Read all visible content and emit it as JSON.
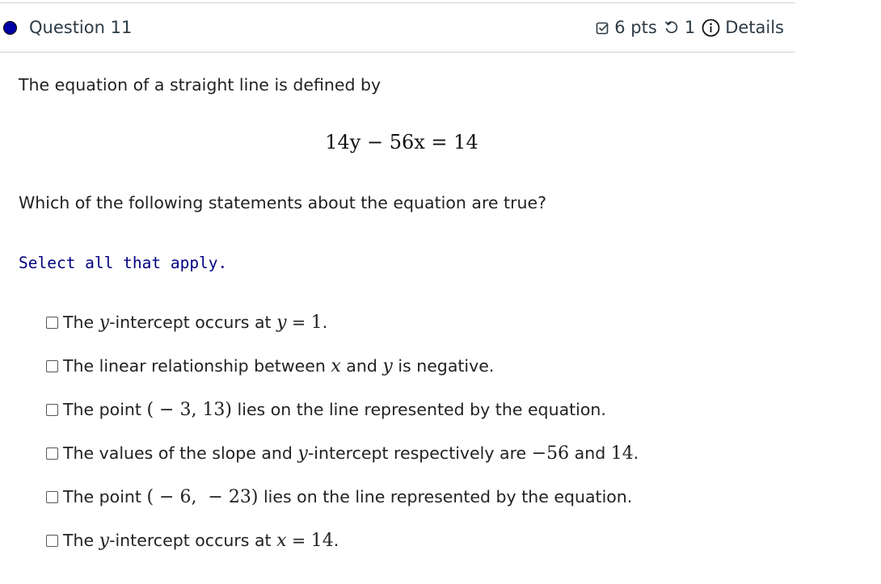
{
  "header": {
    "title": "Question 11",
    "points": "6 pts",
    "attempts": "1",
    "details_label": "Details",
    "status_dot_color": "#0000a8"
  },
  "body": {
    "intro": "The equation of a straight line is defined by",
    "equation": "14y − 56x = 14",
    "question": "Which of the following statements about the equation are true?",
    "instruction": "Select all that apply."
  },
  "options": [
    {
      "parts": [
        {
          "t": "The "
        },
        {
          "m": "y"
        },
        {
          "t": "-intercept occurs at "
        },
        {
          "m": "y"
        },
        {
          "t": " = "
        },
        {
          "n": "1"
        },
        {
          "t": "."
        }
      ],
      "checked": false
    },
    {
      "parts": [
        {
          "t": "The linear relationship between "
        },
        {
          "m": "x"
        },
        {
          "t": " and "
        },
        {
          "m": "y"
        },
        {
          "t": " is negative."
        }
      ],
      "checked": false
    },
    {
      "parts": [
        {
          "t": "The point "
        },
        {
          "n": "( − 3, 13)"
        },
        {
          "t": " lies on the line represented by the equation."
        }
      ],
      "checked": false
    },
    {
      "parts": [
        {
          "t": "The values of the slope and "
        },
        {
          "m": "y"
        },
        {
          "t": "-intercept respectively are "
        },
        {
          "n": "−56"
        },
        {
          "t": " and "
        },
        {
          "n": "14"
        },
        {
          "t": "."
        }
      ],
      "checked": false
    },
    {
      "parts": [
        {
          "t": "The point "
        },
        {
          "n": "( − 6,  − 23)"
        },
        {
          "t": " lies on the line represented by the equation."
        }
      ],
      "checked": false
    },
    {
      "parts": [
        {
          "t": "The "
        },
        {
          "m": "y"
        },
        {
          "t": "-intercept occurs at "
        },
        {
          "m": "x"
        },
        {
          "t": " = "
        },
        {
          "n": "14"
        },
        {
          "t": "."
        }
      ],
      "checked": false
    }
  ]
}
